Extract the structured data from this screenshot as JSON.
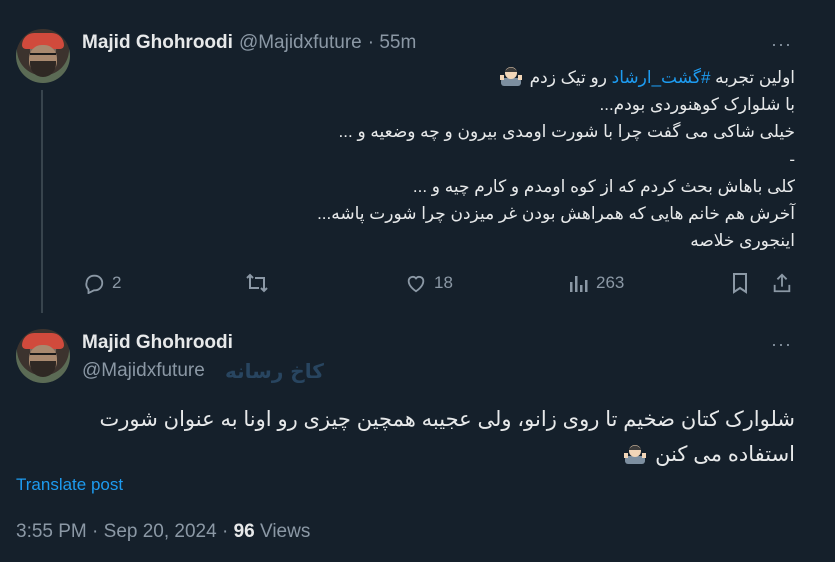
{
  "tweet1": {
    "name": "Majid Ghohroodi",
    "handle": "@Majidxfuture",
    "time": "· 55m",
    "text_lines_before": "اولین تجربه ",
    "hashtag": "#گشت_ارشاد",
    "text_after_hashtag": " رو تیک زدم",
    "lines": [
      "با شلوارک کوهنوردی بودم...",
      "خیلی شاکی می گفت چرا با شورت اومدی بیرون و چه وضعیه و ...",
      "-",
      "کلی باهاش بحث کردم که از کوه اومدم و کارم چیه و ...",
      "آخرش هم خانم هایی که همراهش بودن غر میزدن چرا شورت پاشه...",
      "اینجوری خلاصه"
    ],
    "replies": "2",
    "likes": "18",
    "views": "263"
  },
  "tweet2": {
    "name": "Majid Ghohroodi",
    "handle": "@Majidxfuture",
    "watermark": "کاخ رسانه",
    "text_line1": "شلوارک کتان ضخیم تا روی زانو، ولی عجیبه همچین چیزی رو اونا به عنوان شورت",
    "text_line2": "استفاده می کنن",
    "translate": "Translate post",
    "time": "3:55 PM · Sep 20, 2024 · ",
    "views_count": "96",
    "views_label": " Views"
  },
  "more_label": "···",
  "colors": {
    "background": "#15202b",
    "text": "#e7e9ea",
    "secondary": "#8b98a5",
    "link": "#1d9bf0"
  }
}
